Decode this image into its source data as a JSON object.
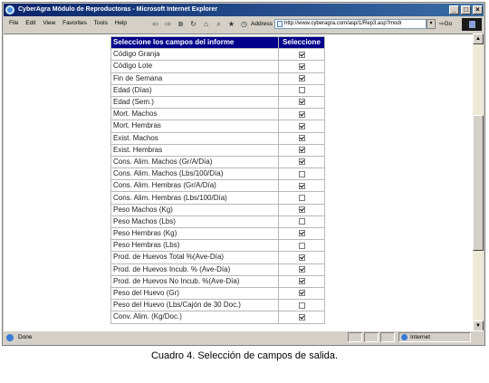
{
  "window": {
    "title": "CyberAgra Módulo de Reproductoras - Microsoft Internet Explorer",
    "controls": [
      "_",
      "□",
      "×"
    ]
  },
  "menu": [
    "File",
    "Edit",
    "View",
    "Favorites",
    "Tools",
    "Help"
  ],
  "address": {
    "label": "Address",
    "url": "http://www.cyberagra.com/asp/1/Rep3.asp?modr",
    "go_label": "Go"
  },
  "table": {
    "header_field": "Seleccione los campos del informe",
    "header_select": "Seleccione",
    "rows": [
      {
        "label": "Código Granja",
        "checked": true
      },
      {
        "label": "Código Lote",
        "checked": true
      },
      {
        "label": "Fin de Semana",
        "checked": true
      },
      {
        "label": "Edad (Días)",
        "checked": false
      },
      {
        "label": "Edad (Sem.)",
        "checked": true
      },
      {
        "label": "Mort. Machos",
        "checked": true
      },
      {
        "label": "Mort. Hembras",
        "checked": true
      },
      {
        "label": "Exist. Machos",
        "checked": true
      },
      {
        "label": "Exist. Hembras",
        "checked": true
      },
      {
        "label": "Cons. Alim. Machos (Gr/A/Día)",
        "checked": true
      },
      {
        "label": "Cons. Alim. Machos (Lbs/100/Día)",
        "checked": false
      },
      {
        "label": "Cons. Alim. Hembras (Gr/A/Día)",
        "checked": true
      },
      {
        "label": "Cons. Alim. Hembras (Lbs/100/Día)",
        "checked": false
      },
      {
        "label": "Peso Machos (Kg)",
        "checked": true
      },
      {
        "label": "Peso Machos (Lbs)",
        "checked": false
      },
      {
        "label": "Peso Hembras (Kg)",
        "checked": true
      },
      {
        "label": "Peso Hembras (Lbs)",
        "checked": false
      },
      {
        "label": "Prod. de Huevos Total %(Ave-Día)",
        "checked": true
      },
      {
        "label": "Prod. de Huevos Incub. % (Ave-Día)",
        "checked": true
      },
      {
        "label": "Prod. de Huevos No Incub. %(Ave-Día)",
        "checked": true
      },
      {
        "label": "Peso del Huevo (Gr)",
        "checked": true
      },
      {
        "label": "Peso del Huevo (Lbs/Cajón de 30 Doc.)",
        "checked": false
      },
      {
        "label": "Conv. Alim. (Kg/Doc.)",
        "checked": true
      }
    ]
  },
  "status": {
    "text": "Done",
    "zone": "Internet"
  },
  "caption": "Cuadro 4. Selección de campos de salida.",
  "colors": {
    "header_bg": "#00008b",
    "title_bar": "#0a246a"
  }
}
